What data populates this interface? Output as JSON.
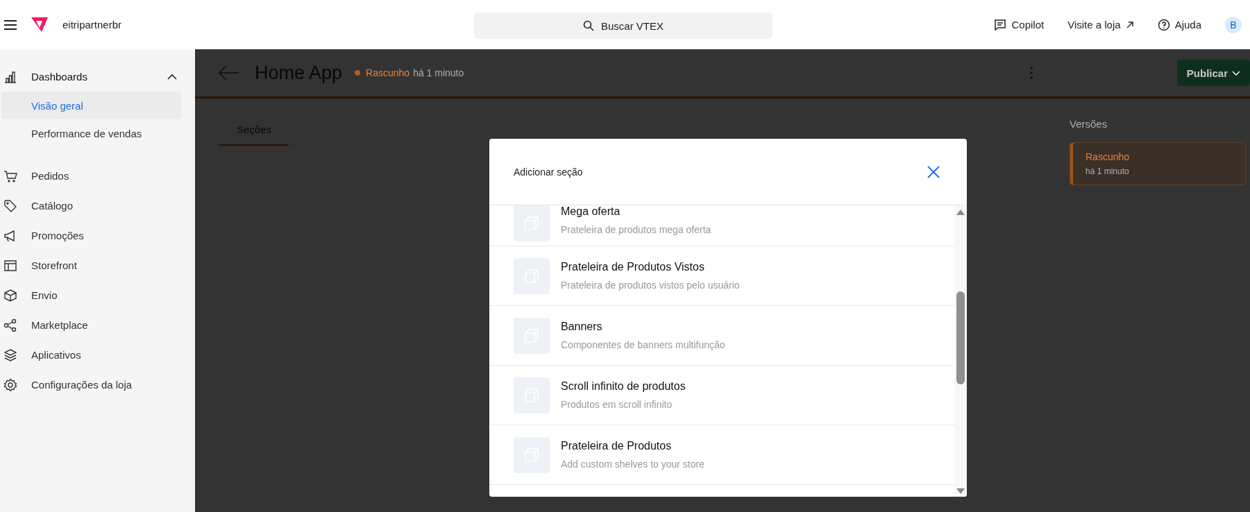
{
  "topbar": {
    "brand": "eitripartnerbr",
    "search": {
      "placeholder": "Buscar VTEX"
    },
    "links": [
      {
        "label": "Copilot",
        "kind": "copilot"
      },
      {
        "label": "Visite a loja",
        "kind": "external"
      },
      {
        "label": "Ajuda",
        "kind": "help"
      }
    ],
    "avatar": "B"
  },
  "sidebar": {
    "items": [
      {
        "label": "Dashboards",
        "kind": "chart",
        "expanded": true,
        "children": [
          {
            "label": "Visão geral",
            "selected": true
          },
          {
            "label": "Performance de vendas",
            "selected": false
          }
        ]
      },
      {
        "label": "Pedidos",
        "kind": "cart"
      },
      {
        "label": "Catálogo",
        "kind": "tag"
      },
      {
        "label": "Promoções",
        "kind": "megaphone"
      },
      {
        "label": "Storefront",
        "kind": "layout"
      },
      {
        "label": "Envio",
        "kind": "box"
      },
      {
        "label": "Marketplace",
        "kind": "share"
      },
      {
        "label": "Aplicativos",
        "kind": "layers"
      },
      {
        "label": "Configurações da loja",
        "kind": "gear"
      }
    ]
  },
  "page": {
    "title": "Home App",
    "status": "Rascunho",
    "status_time": "há 1 minuto",
    "publish": "Publicar",
    "tabs": [
      {
        "label": "Seções",
        "selected": true
      }
    ],
    "versions": {
      "title": "Versões",
      "items": [
        {
          "label": "Rascunho",
          "time": "há 1 minuto",
          "selected": true
        }
      ]
    }
  },
  "modal": {
    "title": "Adicionar seção",
    "items": [
      {
        "title": "Mega oferta",
        "description": "Prateleira de produtos mega oferta"
      },
      {
        "title": "Prateleira de Produtos Vistos",
        "description": "Prateleira de produtos vistos pelo usuário"
      },
      {
        "title": "Banners",
        "description": "Componentes de banners multifunção"
      },
      {
        "title": "Scroll infinito de produtos",
        "description": "Produtos em scroll infinito"
      },
      {
        "title": "Prateleira de Produtos",
        "description": "Add custom shelves to your store"
      }
    ]
  }
}
